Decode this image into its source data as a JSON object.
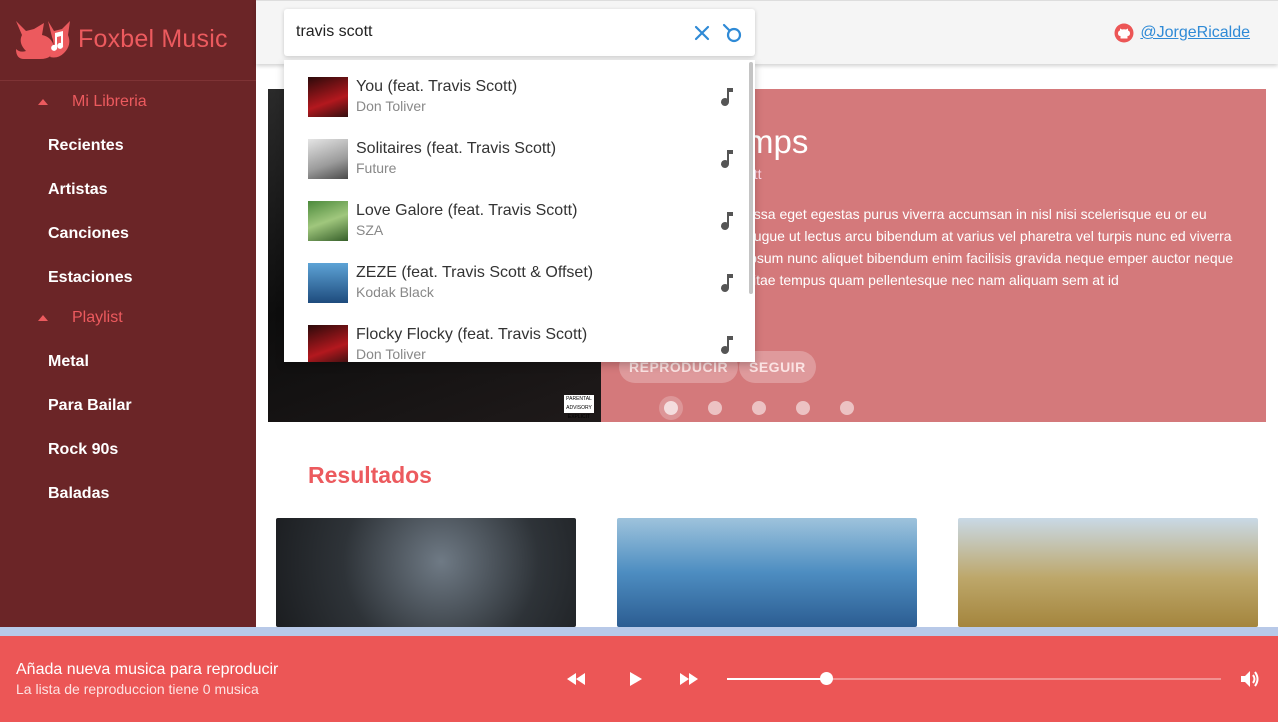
{
  "app": {
    "name": "Foxbel Music"
  },
  "sidebar": {
    "sections": [
      {
        "label": "Mi Libreria",
        "items": [
          "Recientes",
          "Artistas",
          "Canciones",
          "Estaciones"
        ]
      },
      {
        "label": "Playlist",
        "items": [
          "Metal",
          "Para Bailar",
          "Rock 90s",
          "Baladas"
        ]
      }
    ]
  },
  "header": {
    "github_user": "@JorgeRicalde"
  },
  "search": {
    "value": "travis scott",
    "results": [
      {
        "title": "You (feat. Travis Scott)",
        "artist": "Don Toliver"
      },
      {
        "title": "Solitaires (feat. Travis Scott)",
        "artist": "Future"
      },
      {
        "title": "Love Galore (feat. Travis Scott)",
        "artist": "SZA"
      },
      {
        "title": "ZEZE (feat. Travis Scott & Offset)",
        "artist": "Kodak Black"
      },
      {
        "title": "Flocky Flocky (feat. Travis Scott)",
        "artist": "Don Toliver"
      }
    ]
  },
  "banner": {
    "title_visible": "mps",
    "artist_visible": "ott",
    "description_visible": "assa eget egestas purus viverra accumsan in nisl nisi scelerisque eu or eu augue ut lectus arcu bibendum at varius vel pharetra vel turpis nunc ed viverra ipsum nunc aliquet bibendum enim facilisis gravida neque emper auctor neque vitae tempus quam pellentesque nec nam aliquam sem at id",
    "play_label": "REPRODUCIR",
    "follow_label": "SEGUIR",
    "advisory": "PARENTAL ADVISORY EXPLICIT CONTENT",
    "slide_count": 5,
    "active_slide": 1
  },
  "results_section": {
    "title": "Resultados"
  },
  "player": {
    "title": "Añada nueva musica para reproducir",
    "subtitle": "La lista de reproduccion tiene 0 musica",
    "progress_fraction": 0.2
  },
  "colors": {
    "sidebar_bg": "#6b2527",
    "accent": "#ec5a5e",
    "player_bg": "#ec5656",
    "link": "#2f8ad6"
  },
  "icons": {
    "logo": "fox-music-logo-icon",
    "github": "github-icon",
    "clear": "close-icon",
    "search": "search-icon",
    "note": "music-note-icon",
    "prev": "rewind-icon",
    "play": "play-icon",
    "next": "fast-forward-icon",
    "volume": "volume-icon"
  }
}
